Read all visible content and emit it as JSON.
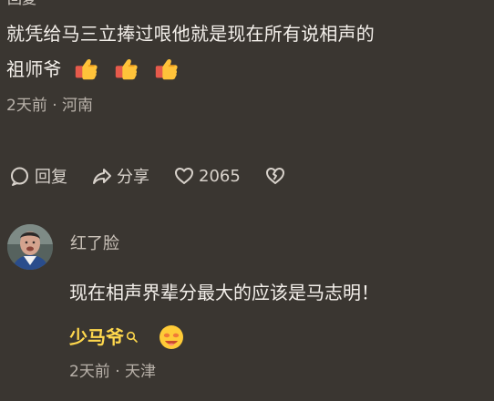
{
  "top_cut_text": "回复",
  "comment": {
    "text_line1": "就凭给马三立捧过哏他就是现在所有说相声的",
    "text_line2": "祖师爷",
    "emojis": [
      "thumbs-up-icon",
      "thumbs-up-icon",
      "thumbs-up-icon"
    ],
    "meta": "2天前 · 河南"
  },
  "actions": {
    "reply": "回复",
    "share": "分享",
    "like_count": "2065"
  },
  "reply": {
    "username": "红了脸",
    "text": "现在相声界辈分最大的应该是马志明！",
    "mention": "少马爷",
    "meta": "2天前 · 天津"
  },
  "colors": {
    "background": "#3a3631",
    "mention": "#ffd84d",
    "text": "#f4f0eb",
    "muted": "#b9b2aa"
  }
}
